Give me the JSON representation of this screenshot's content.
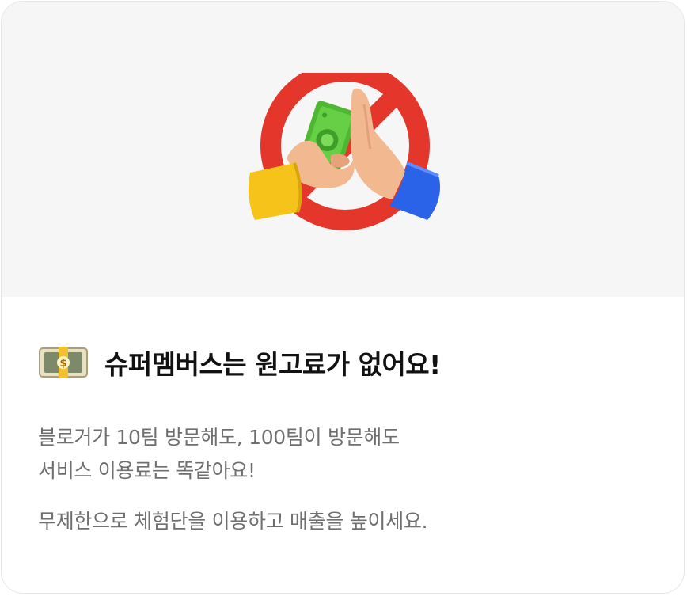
{
  "hero": {
    "illustration": "no-money-exchange-icon"
  },
  "heading": {
    "emoji": "money-bill-icon",
    "title": "슈퍼멤버스는 원고료가 없어요!"
  },
  "description": {
    "line1": "블로거가 10팀 방문해도, 100팀이 방문해도",
    "line2": "서비스 이용료는 똑같아요!",
    "line3": "무제한으로 체험단을 이용하고 매출을 높이세요."
  },
  "colors": {
    "prohibit_red": "#e5362c",
    "cash_green": "#5cc63b",
    "sleeve_yellow": "#f6c31b",
    "sleeve_blue": "#2a63e8",
    "hero_bg": "#f6f6f6",
    "title_text": "#111111",
    "desc_text": "#6f6f6f"
  }
}
